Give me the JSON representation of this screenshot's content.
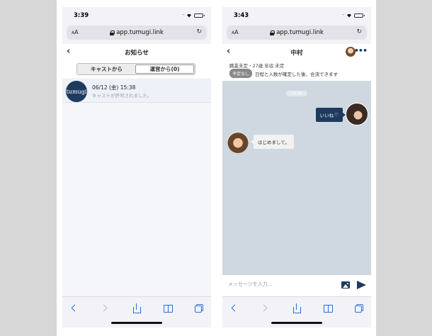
{
  "left": {
    "status": {
      "time": "3:39"
    },
    "browser": {
      "aa_small": "A",
      "aa_big": "A",
      "url": "app.tumugi.link"
    },
    "nav": {
      "title": "お知らせ"
    },
    "segments": {
      "cast": "キャストから",
      "admin": "運営から(0)"
    },
    "notice": {
      "avatar_text": "tumugi",
      "date": "06/12 (金) 15:38",
      "message": "キャストが許可されました。"
    }
  },
  "right": {
    "status": {
      "time": "3:43"
    },
    "browser": {
      "aa_small": "A",
      "aa_big": "A",
      "url": "app.tumugi.link"
    },
    "nav": {
      "title": "中村"
    },
    "profile": {
      "info": "職業未定・27歳 年収 未定",
      "badge": "予定なし",
      "note": "日程と入数が確定した後、合流できます"
    },
    "chat": {
      "date_label": "16:42",
      "like_text": "いいね",
      "heart": "♡",
      "hello_text": "はじめまして。"
    },
    "input": {
      "placeholder": "メッセージを入力..."
    }
  },
  "colors": {
    "navy": "#1f3a5f",
    "safari_blue": "#2f6fd6",
    "chat_bg": "#cfd8e0"
  },
  "icons": [
    "back-chevron-icon",
    "more-icon",
    "lock-icon",
    "reload-icon",
    "wifi-icon",
    "battery-icon",
    "image-icon",
    "send-icon",
    "share-icon",
    "bookmarks-icon",
    "tabs-icon",
    "heart-icon"
  ]
}
